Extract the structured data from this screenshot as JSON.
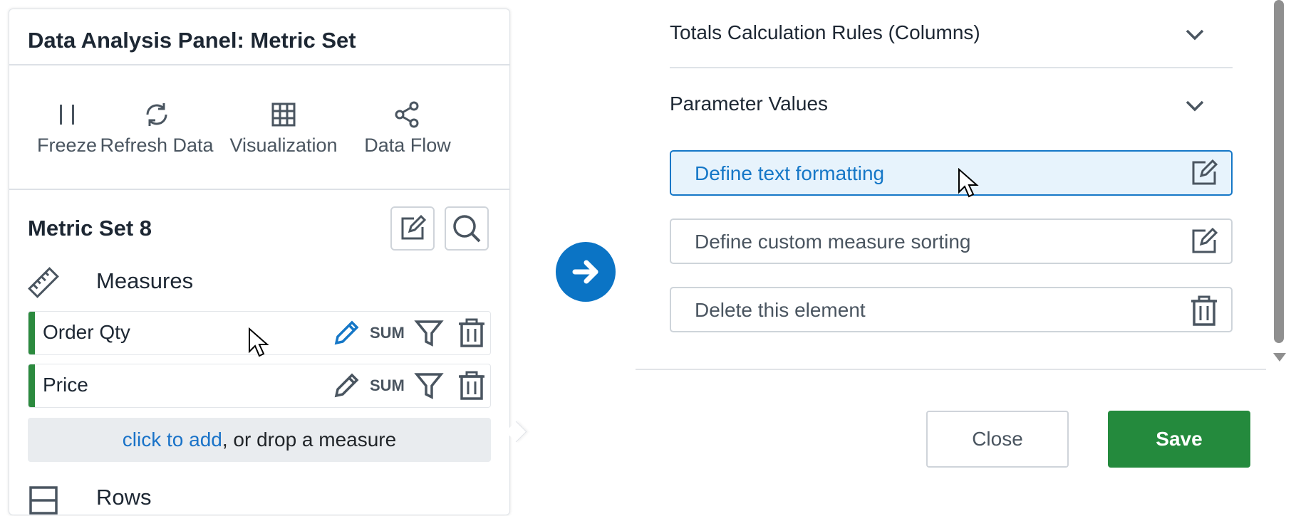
{
  "panel": {
    "title": "Data Analysis Panel: Metric Set",
    "toolbar": [
      {
        "label": "Freeze",
        "icon": "pause-icon"
      },
      {
        "label": "Refresh Data",
        "icon": "refresh-icon"
      },
      {
        "label": "Visualization",
        "icon": "grid-icon"
      },
      {
        "label": "Data Flow",
        "icon": "share-nodes-icon"
      }
    ],
    "metric_set": {
      "name": "Metric Set 8",
      "edit_icon": "edit-square-icon",
      "search_icon": "search-icon"
    },
    "measures_section": {
      "label": "Measures",
      "icon": "ruler-icon",
      "items": [
        {
          "name": "Order Qty",
          "aggregation": "SUM",
          "active_edit": true
        },
        {
          "name": "Price",
          "aggregation": "SUM",
          "active_edit": false
        }
      ],
      "add_link": "click to add",
      "add_rest": ", or drop a measure"
    },
    "rows_section": {
      "label": "Rows",
      "icon": "rows-icon"
    }
  },
  "right": {
    "accordions": [
      {
        "label": "Totals Calculation Rules (Columns)"
      },
      {
        "label": "Parameter Values"
      }
    ],
    "actions": [
      {
        "label": "Define text formatting",
        "icon": "edit-square-icon",
        "active": true
      },
      {
        "label": "Define custom measure sorting",
        "icon": "edit-square-icon",
        "active": false
      },
      {
        "label": "Delete this element",
        "icon": "trash-icon",
        "active": false
      }
    ],
    "buttons": {
      "close": "Close",
      "save": "Save"
    }
  },
  "colors": {
    "accent_blue": "#0b74c5",
    "save_green": "#248a3d",
    "measure_bar_green": "#2b8a3e",
    "active_bg": "#e7f3fc"
  }
}
